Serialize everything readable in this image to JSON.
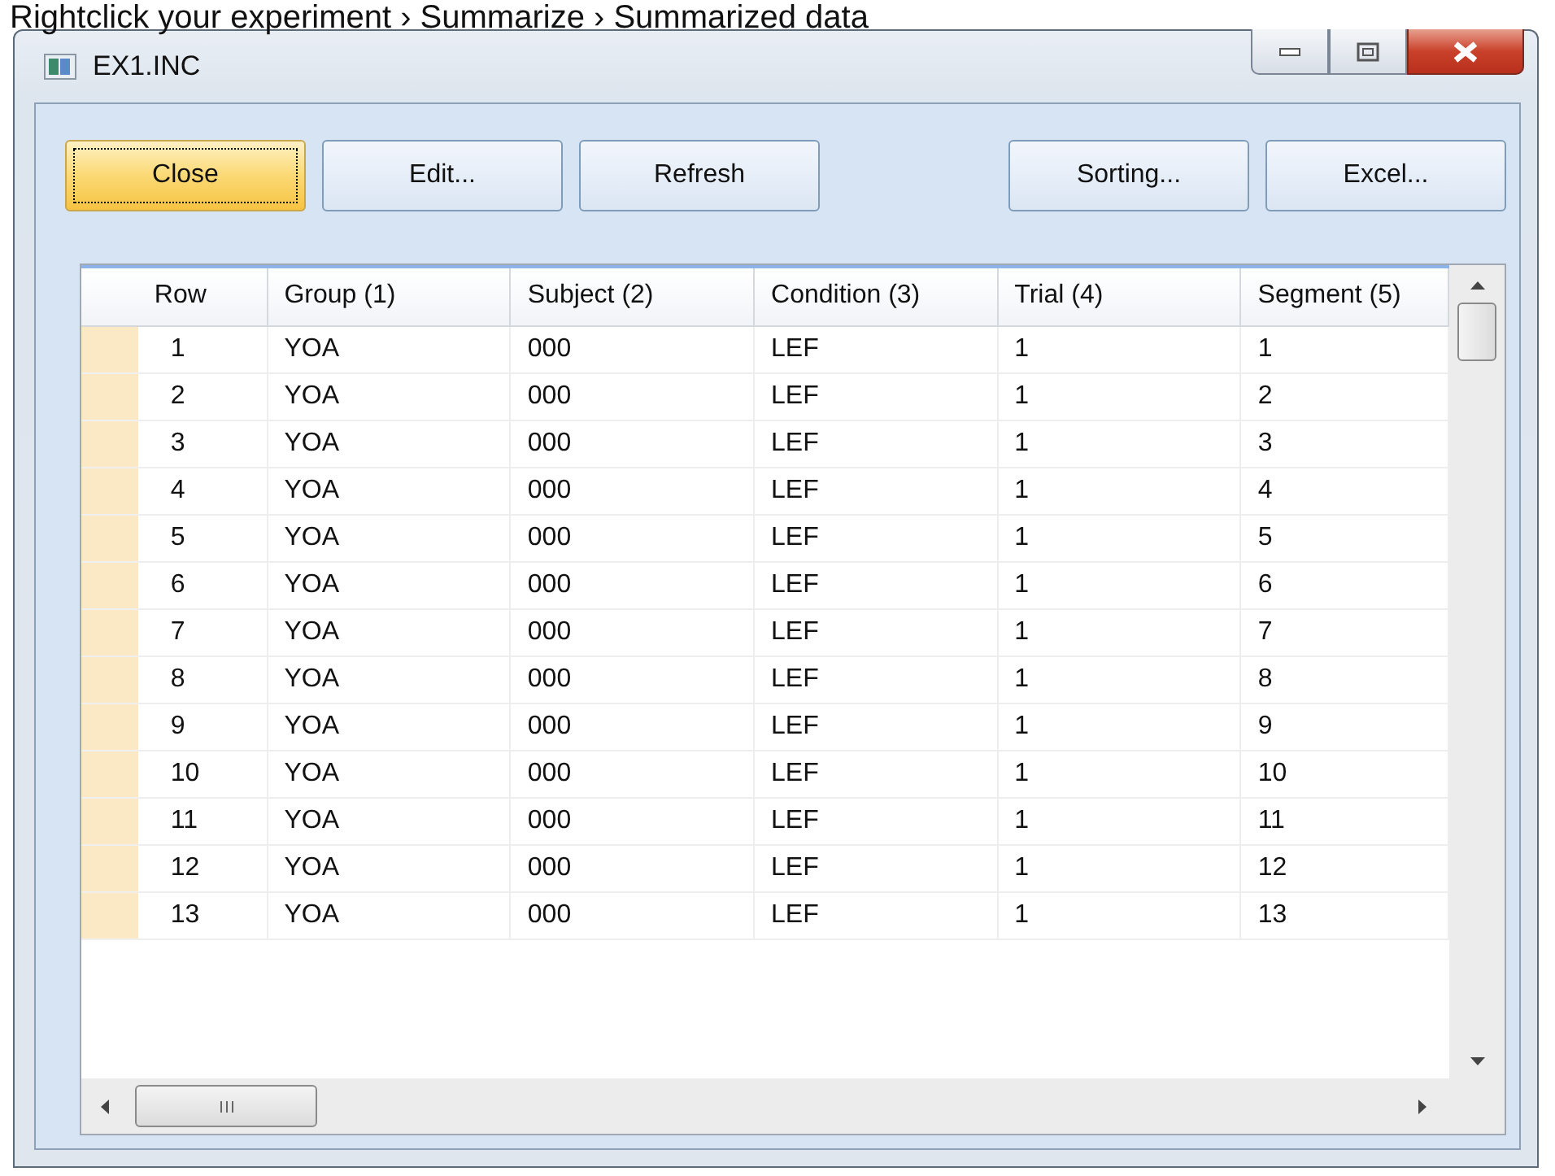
{
  "caption": "Rightclick your experiment › Summarize › Summarized data",
  "window": {
    "title": "EX1.INC"
  },
  "buttons": [
    {
      "label": "Close",
      "default": true
    },
    {
      "label": "Edit...",
      "default": false
    },
    {
      "label": "Refresh",
      "default": false
    },
    {
      "label": "Sorting...",
      "default": false
    },
    {
      "label": "Excel...",
      "default": false
    }
  ],
  "table": {
    "columns": [
      "Row",
      "Group (1)",
      "Subject (2)",
      "Condition (3)",
      "Trial (4)",
      "Segment (5)"
    ],
    "rows": [
      [
        "1",
        "YOA",
        "000",
        "LEF",
        "1",
        "1"
      ],
      [
        "2",
        "YOA",
        "000",
        "LEF",
        "1",
        "2"
      ],
      [
        "3",
        "YOA",
        "000",
        "LEF",
        "1",
        "3"
      ],
      [
        "4",
        "YOA",
        "000",
        "LEF",
        "1",
        "4"
      ],
      [
        "5",
        "YOA",
        "000",
        "LEF",
        "1",
        "5"
      ],
      [
        "6",
        "YOA",
        "000",
        "LEF",
        "1",
        "6"
      ],
      [
        "7",
        "YOA",
        "000",
        "LEF",
        "1",
        "7"
      ],
      [
        "8",
        "YOA",
        "000",
        "LEF",
        "1",
        "8"
      ],
      [
        "9",
        "YOA",
        "000",
        "LEF",
        "1",
        "9"
      ],
      [
        "10",
        "YOA",
        "000",
        "LEF",
        "1",
        "10"
      ],
      [
        "11",
        "YOA",
        "000",
        "LEF",
        "1",
        "11"
      ],
      [
        "12",
        "YOA",
        "000",
        "LEF",
        "1",
        "12"
      ],
      [
        "13",
        "YOA",
        "000",
        "LEF",
        "1",
        "13"
      ]
    ]
  }
}
